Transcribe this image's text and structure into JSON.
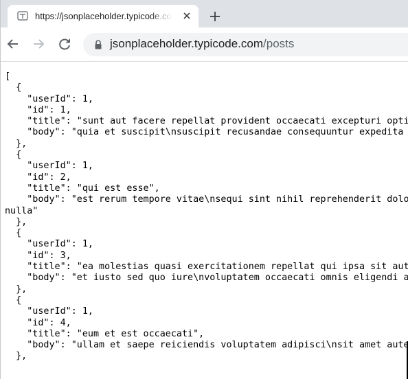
{
  "browser": {
    "tab": {
      "title": "https://jsonplaceholder.typicode.com/posts",
      "favicon": "json-page-icon",
      "close_icon": "close-icon"
    },
    "new_tab_icon": "plus-icon",
    "toolbar": {
      "back_icon": "arrow-left-icon",
      "forward_icon": "arrow-right-icon",
      "reload_icon": "reload-icon",
      "lock_icon": "lock-icon",
      "url_host": "jsonplaceholder.typicode.com",
      "url_path": "/posts"
    }
  },
  "colors": {
    "tabstrip": "#dee1e6",
    "omnibox": "#f1f3f4",
    "icon": "#5f6368",
    "icon_disabled": "#bdc1c6",
    "text": "#202124"
  },
  "content": {
    "lines": [
      "[",
      "  {",
      "    \"userId\": 1,",
      "    \"id\": 1,",
      "    \"title\": \"sunt aut facere repellat provident occaecati excepturi optio reprehenderit\",",
      "    \"body\": \"quia et suscipit\\nsuscipit recusandae consequuntur expedita et cum\",",
      "  },",
      "  {",
      "    \"userId\": 1,",
      "    \"id\": 2,",
      "    \"title\": \"qui est esse\",",
      "    \"body\": \"est rerum tempore vitae\\nsequi sint nihil reprehenderit dolor beatae ea",
      "nulla\"",
      "  },",
      "  {",
      "    \"userId\": 1,",
      "    \"id\": 3,",
      "    \"title\": \"ea molestias quasi exercitationem repellat qui ipsa sit aut\",",
      "    \"body\": \"et iusto sed quo iure\\nvoluptatem occaecati omnis eligendi aut ad\",",
      "  },",
      "  {",
      "    \"userId\": 1,",
      "    \"id\": 4,",
      "    \"title\": \"eum et est occaecati\",",
      "    \"body\": \"ullam et saepe reiciendis voluptatem adipisci\\nsit amet autem assumenda\",",
      "  },"
    ]
  }
}
